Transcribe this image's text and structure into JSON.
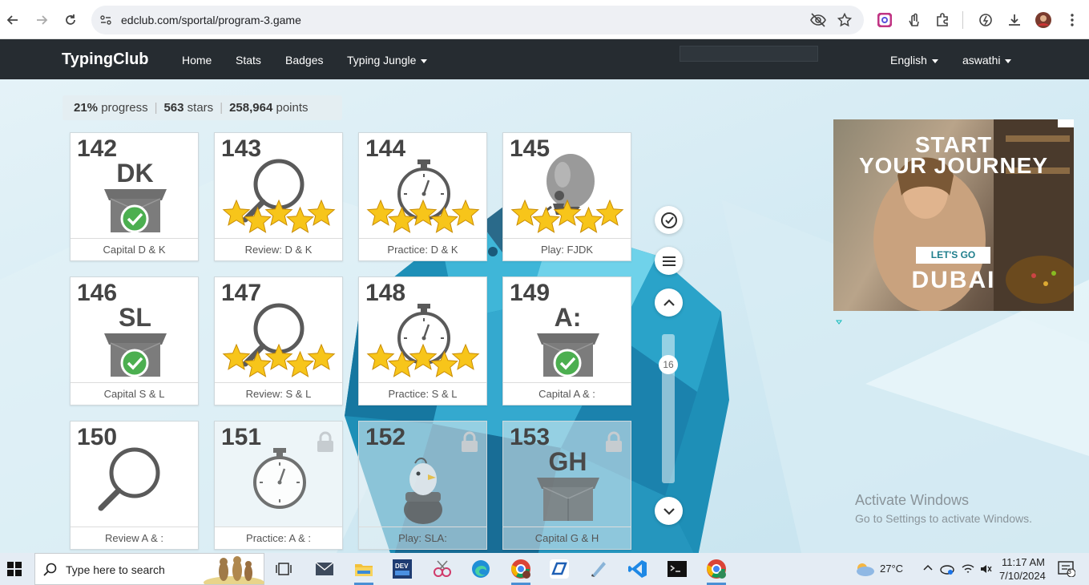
{
  "browser": {
    "url": "edclub.com/sportal/program-3.game"
  },
  "nav": {
    "brand": "TypingClub",
    "links": [
      "Home",
      "Stats",
      "Badges"
    ],
    "jungle": "Typing Jungle",
    "language": "English",
    "user": "aswathi"
  },
  "progress": {
    "percent": "21%",
    "percent_label": "progress",
    "stars": "563",
    "stars_label": "stars",
    "points": "258,964",
    "points_label": "points"
  },
  "lessons": [
    {
      "num": "142",
      "code": "DK",
      "art": "box",
      "title": "Capital D & K",
      "stars": 0,
      "done": true,
      "locked": false
    },
    {
      "num": "143",
      "code": "",
      "art": "magnifier",
      "title": "Review: D & K",
      "stars": 5,
      "done": true,
      "locked": false
    },
    {
      "num": "144",
      "code": "",
      "art": "stopwatch",
      "title": "Practice: D & K",
      "stars": 5,
      "done": true,
      "locked": false
    },
    {
      "num": "145",
      "code": "",
      "art": "balloon",
      "title": "Play: FJDK",
      "stars": 5,
      "done": true,
      "locked": false
    },
    {
      "num": "146",
      "code": "SL",
      "art": "box",
      "title": "Capital S & L",
      "stars": 0,
      "done": true,
      "locked": false
    },
    {
      "num": "147",
      "code": "",
      "art": "magnifier",
      "title": "Review: S & L",
      "stars": 5,
      "done": true,
      "locked": false
    },
    {
      "num": "148",
      "code": "",
      "art": "stopwatch",
      "title": "Practice: S & L",
      "stars": 5,
      "done": true,
      "locked": false
    },
    {
      "num": "149",
      "code": "A:",
      "art": "box",
      "title": "Capital A & :",
      "stars": 0,
      "done": true,
      "locked": false
    },
    {
      "num": "150",
      "code": "",
      "art": "magnifier",
      "title": "Review A & :",
      "stars": 0,
      "done": false,
      "locked": false
    },
    {
      "num": "151",
      "code": "",
      "art": "stopwatch",
      "title": "Practice: A & :",
      "stars": 0,
      "done": false,
      "locked": true
    },
    {
      "num": "152",
      "code": "",
      "art": "bird",
      "title": "Play: SLA:",
      "stars": 0,
      "done": false,
      "locked": true
    },
    {
      "num": "153",
      "code": "GH",
      "art": "box",
      "title": "Capital G & H",
      "stars": 0,
      "done": false,
      "locked": true
    }
  ],
  "sidebar": {
    "page_number": "16"
  },
  "ad": {
    "line1": "START",
    "line2": "YOUR JOURNEY",
    "cta": "LET'S GO",
    "brand": "DUBAI"
  },
  "watermark": {
    "line1": "Activate Windows",
    "line2": "Go to Settings to activate Windows."
  },
  "taskbar": {
    "search_placeholder": "Type here to search",
    "weather": "27°C",
    "time": "11:17 AM",
    "date": "7/10/2024",
    "notifications": "3"
  },
  "colors": {
    "nav_bg": "#262c31",
    "star": "#f7c51a",
    "check": "#4caf50",
    "ice": "#1e8fb7"
  }
}
